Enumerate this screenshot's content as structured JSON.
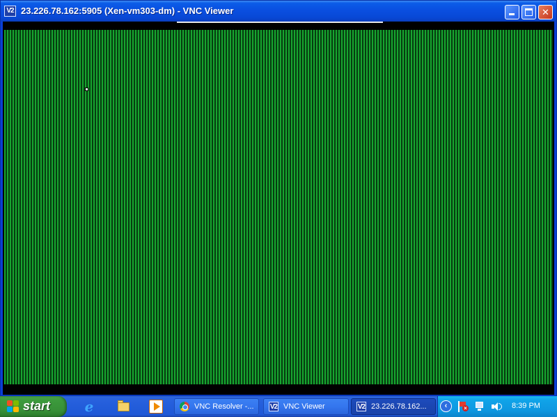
{
  "window": {
    "title": "23.226.78.162:5905 (Xen-vm303-dm) - VNC Viewer",
    "icon_text": "V2",
    "buttons": {
      "minimize_icon": "minimize-icon",
      "maximize_icon": "maximize-icon",
      "close_icon": "close-icon",
      "close_glyph": "✕"
    }
  },
  "remote_screen": {
    "pattern": "vertical-stripes",
    "colors": {
      "stripe_light": "#17a52f",
      "stripe_dark": "#063c10",
      "border": "#000000"
    }
  },
  "taskbar": {
    "start_label": "start",
    "quick_launch": [
      {
        "icon": "internet-explorer-icon",
        "glyph": "e"
      },
      {
        "icon": "folder-icon"
      },
      {
        "icon": "media-player-icon"
      }
    ],
    "tasks": [
      {
        "label": "VNC Resolver -...",
        "icon": "chrome-icon",
        "active": false
      },
      {
        "label": "VNC Viewer",
        "icon": "vnc-viewer-icon",
        "icon_text": "V2",
        "active": false
      },
      {
        "label": "23.226.78.162...",
        "icon": "vnc-viewer-icon",
        "icon_text": "V2",
        "active": true
      }
    ],
    "tray": {
      "toggle_glyph": "‹",
      "icons": [
        "security-alert-icon",
        "network-icon",
        "volume-icon"
      ],
      "alert_glyph": "×",
      "clock": "8:39 PM"
    }
  },
  "colors": {
    "titlebar": "#0a4fe0",
    "taskbar": "#245edb",
    "start_button": "#378f37",
    "tray": "#0e97e0"
  }
}
